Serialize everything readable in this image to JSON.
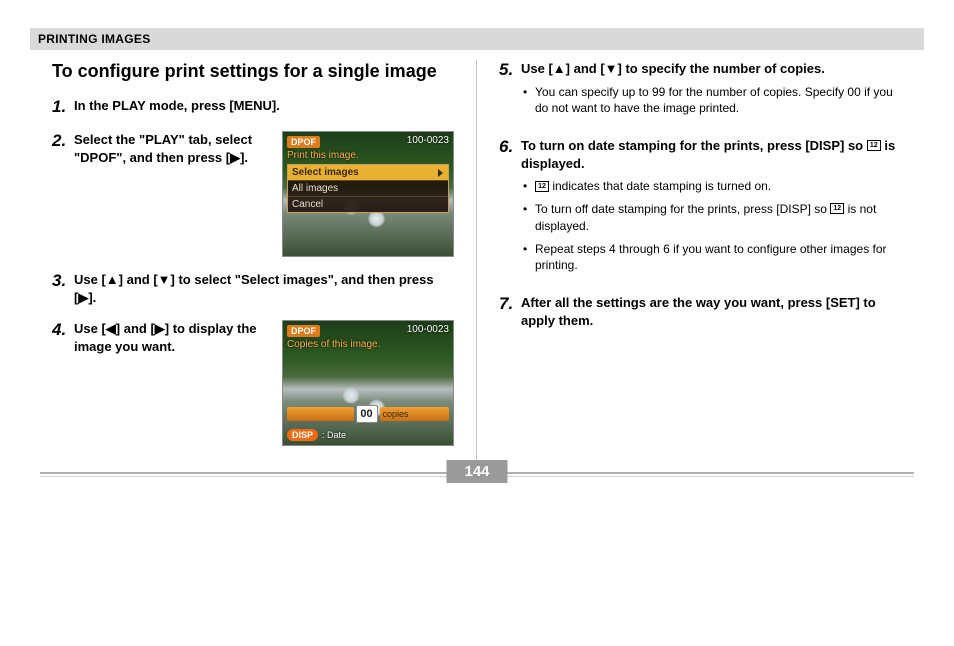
{
  "header": {
    "section": "PRINTING IMAGES"
  },
  "title": "To configure print settings for a single image",
  "steps_left": [
    {
      "num": "1.",
      "text": "In the PLAY mode, press [MENU]."
    },
    {
      "num": "2.",
      "text": "Select the \"PLAY\" tab, select \"DPOF\", and then press [▶]."
    },
    {
      "num": "3.",
      "text": "Use [▲] and [▼] to select \"Select images\", and then press [▶]."
    },
    {
      "num": "4.",
      "text": "Use [◀] and [▶] to display the image you want."
    }
  ],
  "steps_right": [
    {
      "num": "5.",
      "text": "Use [▲] and [▼] to specify the number of copies.",
      "bullets": [
        "You can specify up to 99 for the number of copies. Specify 00 if you do not want to have the image printed."
      ]
    },
    {
      "num": "6.",
      "text": "To turn on date stamping for the prints, press [DISP] so 📅 is displayed.",
      "bullets_html": [
        {
          "pre": "",
          "icon": true,
          "post": " indicates that date stamping is turned on."
        },
        {
          "pre": "To turn off date stamping for the prints, press [DISP] so ",
          "icon": true,
          "post": " is not displayed."
        },
        {
          "pre": "Repeat steps 4 through 6 if you want to configure other images for printing.",
          "icon": false,
          "post": ""
        }
      ]
    },
    {
      "num": "7.",
      "text": "After all the settings are the way you want, press [SET] to apply them."
    }
  ],
  "lcd1": {
    "tag": "DPOF",
    "file": "100-0023",
    "subtitle": "Print this image.",
    "menu": [
      "Select images",
      "All images",
      "Cancel"
    ],
    "selected": 0
  },
  "lcd2": {
    "tag": "DPOF",
    "file": "100-0023",
    "subtitle": "Copies of this image.",
    "copies_num": "00",
    "copies_label": "copies",
    "disp_btn": "DISP",
    "disp_label": ": Date"
  },
  "page_number": "144"
}
